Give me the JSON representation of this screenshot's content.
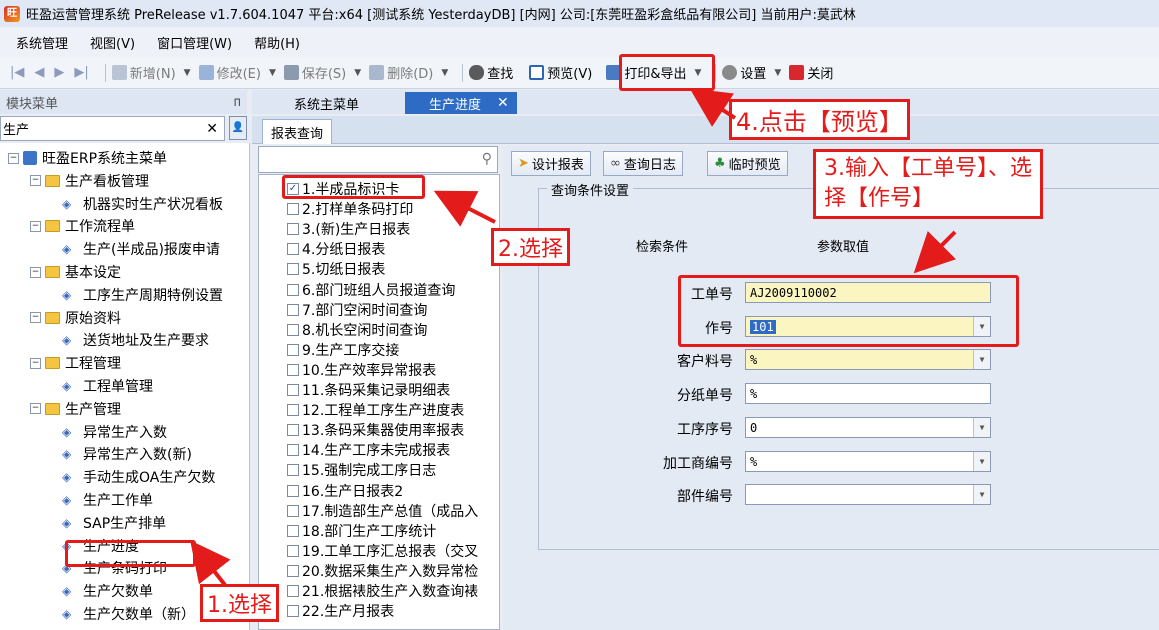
{
  "window": {
    "title": "旺盈运营管理系统 PreRelease v1.7.604.1047 平台:x64  [测试系统 YesterdayDB] [内网] 公司:[东莞旺盈彩盒纸品有限公司] 当前用户:莫武林"
  },
  "menu": [
    "系统管理",
    "视图(V)",
    "窗口管理(W)",
    "帮助(H)"
  ],
  "toolbar": {
    "new": "新增(N)",
    "edit": "修改(E)",
    "save": "保存(S)",
    "delete": "删除(D)",
    "find": "查找",
    "preview": "预览(V)",
    "print_export": "打印&导出",
    "settings": "设置",
    "close": "关闭"
  },
  "left_panel": {
    "header": "模块菜单",
    "pin": "ᴨ",
    "search_value": "生产",
    "clear": "✕",
    "tree": [
      {
        "label": "旺盈ERP系统主菜单",
        "level": 0,
        "type": "root"
      },
      {
        "label": "生产看板管理",
        "level": 1,
        "type": "folder"
      },
      {
        "label": "机器实时生产状况看板",
        "level": 2,
        "type": "leaf"
      },
      {
        "label": "工作流程单",
        "level": 1,
        "type": "folder"
      },
      {
        "label": "生产(半成品)报废申请",
        "level": 2,
        "type": "leaf"
      },
      {
        "label": "基本设定",
        "level": 1,
        "type": "folder"
      },
      {
        "label": "工序生产周期特例设置",
        "level": 2,
        "type": "leaf"
      },
      {
        "label": "原始资料",
        "level": 1,
        "type": "folder"
      },
      {
        "label": "送货地址及生产要求",
        "level": 2,
        "type": "leaf"
      },
      {
        "label": "工程管理",
        "level": 1,
        "type": "folder"
      },
      {
        "label": "工程单管理",
        "level": 2,
        "type": "leaf"
      },
      {
        "label": "生产管理",
        "level": 1,
        "type": "folder"
      },
      {
        "label": "异常生产入数",
        "level": 2,
        "type": "leaf"
      },
      {
        "label": "异常生产入数(新)",
        "level": 2,
        "type": "leaf"
      },
      {
        "label": "手动生成OA生产欠数",
        "level": 2,
        "type": "leaf"
      },
      {
        "label": "生产工作单",
        "level": 2,
        "type": "leaf"
      },
      {
        "label": "SAP生产排单",
        "level": 2,
        "type": "leaf"
      },
      {
        "label": "生产进度",
        "level": 2,
        "type": "leaf"
      },
      {
        "label": "生产条码打印",
        "level": 2,
        "type": "leaf"
      },
      {
        "label": "生产欠数单",
        "level": 2,
        "type": "leaf"
      },
      {
        "label": "生产欠数单（新）",
        "level": 2,
        "type": "leaf"
      }
    ]
  },
  "tabs": [
    {
      "label": "系统主菜单",
      "active": false
    },
    {
      "label": "生产进度",
      "active": true
    }
  ],
  "tab_close": "✕",
  "subtab": "报表查询",
  "report_list": [
    {
      "label": "1.半成品标识卡",
      "checked": true
    },
    {
      "label": "2.打样单条码打印",
      "checked": false
    },
    {
      "label": "3.(新)生产日报表",
      "checked": false
    },
    {
      "label": "4.分纸日报表",
      "checked": false
    },
    {
      "label": "5.切纸日报表",
      "checked": false
    },
    {
      "label": "6.部门班组人员报道查询",
      "checked": false
    },
    {
      "label": "7.部门空闲时间查询",
      "checked": false
    },
    {
      "label": "8.机长空闲时间查询",
      "checked": false
    },
    {
      "label": "9.生产工序交接",
      "checked": false
    },
    {
      "label": "10.生产效率异常报表",
      "checked": false
    },
    {
      "label": "11.条码采集记录明细表",
      "checked": false
    },
    {
      "label": "12.工程单工序生产进度表",
      "checked": false
    },
    {
      "label": "13.条码采集器使用率报表",
      "checked": false
    },
    {
      "label": "14.生产工序未完成报表",
      "checked": false
    },
    {
      "label": "15.强制完成工序日志",
      "checked": false
    },
    {
      "label": "16.生产日报表2",
      "checked": false
    },
    {
      "label": "17.制造部生产总值（成品入",
      "checked": false
    },
    {
      "label": "18.部门生产工序统计",
      "checked": false
    },
    {
      "label": "19.工单工序汇总报表（交叉",
      "checked": false
    },
    {
      "label": "20.数据采集生产入数异常检",
      "checked": false
    },
    {
      "label": "21.根据裱胶生产入数查询裱",
      "checked": false
    },
    {
      "label": "22.生产月报表",
      "checked": false
    }
  ],
  "right_panel": {
    "buttons": [
      "设计报表",
      "查询日志",
      "临时预览"
    ],
    "fieldset_title": "查询条件设置",
    "col_condition": "检索条件",
    "col_value": "参数取值",
    "fields": [
      {
        "label": "工单号",
        "value": "AJ2009110002",
        "yellow": true,
        "dropdown": false,
        "selected": false
      },
      {
        "label": "作号",
        "value": "101",
        "yellow": true,
        "dropdown": true,
        "selected": true
      },
      {
        "label": "客户料号",
        "value": "%",
        "yellow": true,
        "dropdown": true,
        "selected": false
      },
      {
        "label": "分纸单号",
        "value": "%",
        "yellow": false,
        "dropdown": false,
        "selected": false
      },
      {
        "label": "工序序号",
        "value": "0",
        "yellow": false,
        "dropdown": true,
        "selected": false
      },
      {
        "label": "加工商编号",
        "value": "%",
        "yellow": false,
        "dropdown": true,
        "selected": false
      },
      {
        "label": "部件编号",
        "value": "",
        "yellow": false,
        "dropdown": true,
        "selected": false
      }
    ]
  },
  "annotations": {
    "step1": "1.选择",
    "step2": "2.选择",
    "step3_line1": "3.输入【工单号】、选",
    "step3_line2": "择【作号】",
    "step4": "4.点击【预览】",
    "color": "#e41b1b"
  }
}
